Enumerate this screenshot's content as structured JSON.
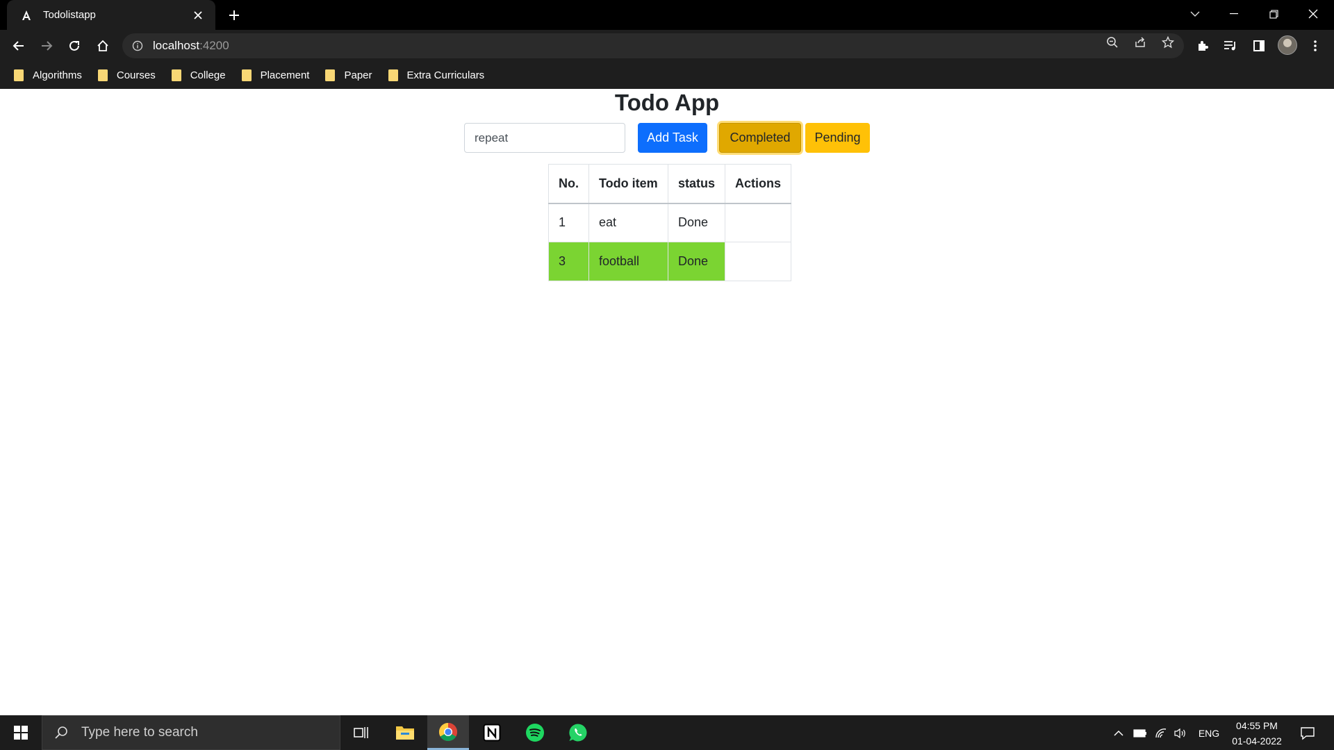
{
  "browser": {
    "tab_title": "Todolistapp",
    "url_host": "localhost",
    "url_port": ":4200",
    "bookmarks": [
      "Algorithms",
      "Courses",
      "College",
      "Placement",
      "Paper",
      "Extra Curriculars"
    ]
  },
  "app": {
    "title": "Todo App",
    "input_value": "repeat",
    "add_label": "Add Task",
    "completed_label": "Completed",
    "pending_label": "Pending",
    "table": {
      "headers": [
        "No.",
        "Todo item",
        "status",
        "Actions"
      ],
      "rows": [
        {
          "no": "1",
          "item": "eat",
          "status": "Done",
          "actions": "",
          "highlight": false
        },
        {
          "no": "3",
          "item": "football",
          "status": "Done",
          "actions": "",
          "highlight": true
        }
      ],
      "highlight_color": "#7bd432"
    }
  },
  "taskbar": {
    "search_placeholder": "Type here to search",
    "language": "ENG",
    "time": "04:55 PM",
    "date": "01-04-2022"
  },
  "colors": {
    "add_button": "#0d6efd",
    "completed_button": "#e0a800",
    "pending_button": "#ffc107"
  }
}
